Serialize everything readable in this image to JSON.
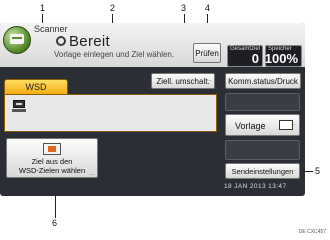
{
  "callouts": [
    "1",
    "2",
    "3",
    "4",
    "5",
    "6"
  ],
  "app": {
    "title": "Scanner"
  },
  "status": {
    "text": "Bereit",
    "message": "Vorlage einlegen und Ziel wählen."
  },
  "buttons": {
    "check": "Prüfen",
    "switch_dest": "Ziell. umschalt.",
    "comm_status": "Komm.status/Druck",
    "original": "Vorlage",
    "send_settings": "Sendeinstellungen",
    "select_from_list_line1": "Ziel aus den",
    "select_from_list_line2": "WSD-Zielen wählen"
  },
  "counters": {
    "total_label": "Gesamtziel",
    "total_value": "0",
    "memory_label": "Speicher",
    "memory_value": "100%"
  },
  "tab": {
    "label": "WSD"
  },
  "datetime": "18 JAN  2013 13:47",
  "footer_code": "DE CXC457"
}
